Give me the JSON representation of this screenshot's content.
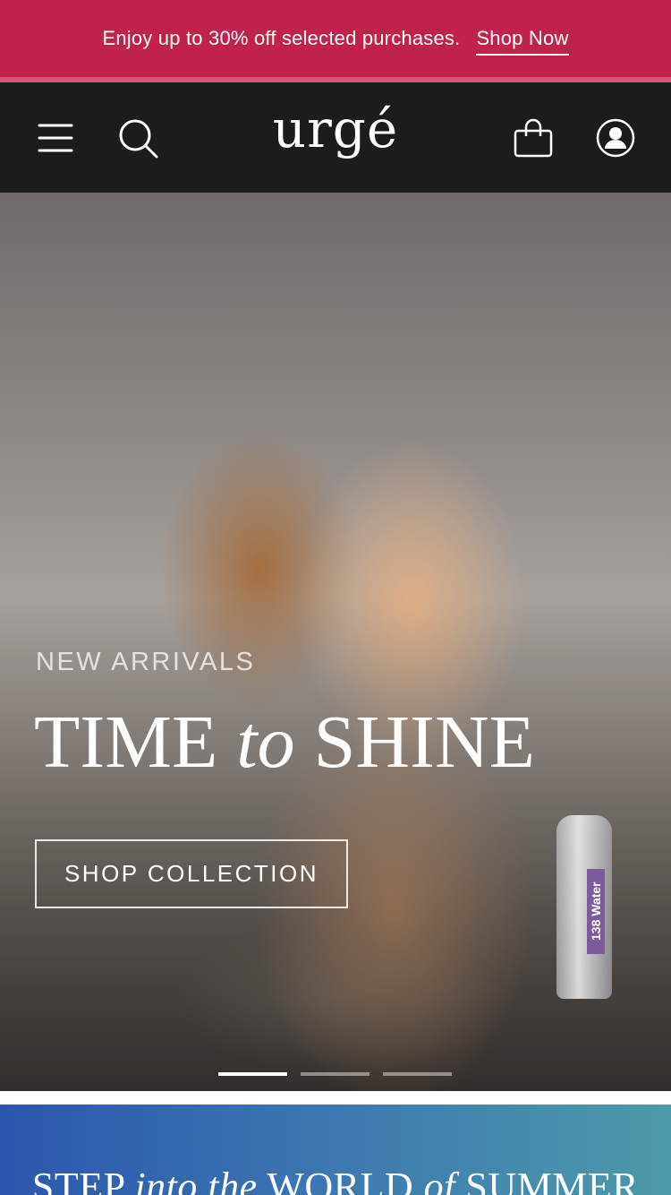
{
  "promo": {
    "message": "Enjoy up to 30% off selected purchases.",
    "link_label": "Shop Now",
    "background_color": "#c0224b"
  },
  "header": {
    "logo": "urgé",
    "icons": [
      "menu-icon",
      "search-icon",
      "shopping-bag-icon",
      "account-icon"
    ],
    "background_color": "#1d1c1c"
  },
  "hero": {
    "eyebrow": "NEW ARRIVALS",
    "headline_part1": "TIME",
    "headline_italic": "to",
    "headline_part2": "SHINE",
    "cta_label": "SHOP COLLECTION",
    "bottle_label": "138 Water",
    "carousel": {
      "slides": 3,
      "active_index": 0
    }
  },
  "summer_banner": {
    "part1": "STEP",
    "italic1": "into the",
    "part2": "WORLD",
    "italic2": "of",
    "part3": "SUMMER",
    "gradient": [
      "#2b56ad",
      "#4d9aa9"
    ]
  }
}
